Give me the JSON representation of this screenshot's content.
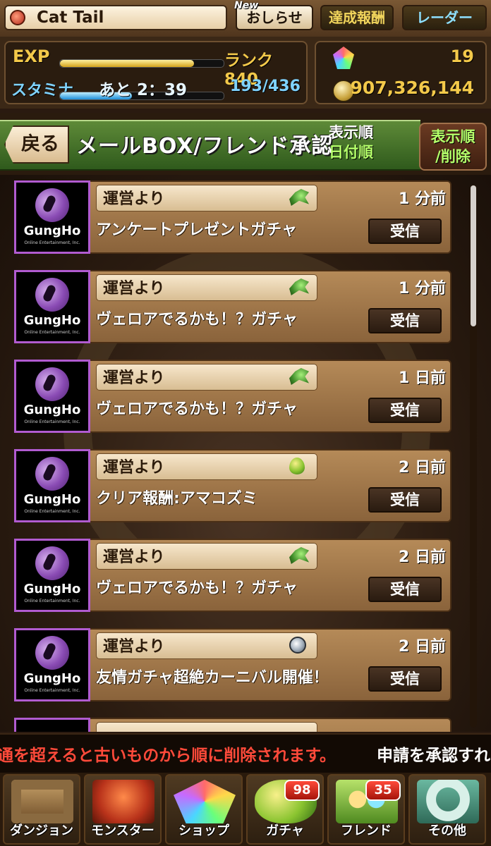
{
  "player": {
    "name": "Cat  Tail"
  },
  "header": {
    "news_new_badge": "New",
    "news_label": "おしらせ",
    "achievements_label": "達成報酬",
    "radar_label": "レーダー"
  },
  "status": {
    "exp_label": "EXP",
    "exp_progress": 0.82,
    "rank_text": "ランク 840",
    "stamina_label": "スタミナ",
    "stamina_timer": "あと 2：39",
    "stamina_value": "193/436",
    "stamina_progress": 0.44,
    "magic_stones": "19",
    "coins": "907,326,144"
  },
  "title_bar": {
    "back_label": "戻る",
    "title": "メールBOX/フレンド承認",
    "sort_label": "表示順",
    "sort_value": "日付順",
    "sort_delete_label_1": "表示順",
    "sort_delete_label_2": "/削除"
  },
  "mails": [
    {
      "logo": "GungHo",
      "logo_sub": "Online Entertainment, Inc.",
      "sender": "運営より",
      "attachment_icon": "dragon-icon",
      "time": "1 分前",
      "subject": "アンケートプレゼントガチャ",
      "button": "受信"
    },
    {
      "logo": "GungHo",
      "logo_sub": "Online Entertainment, Inc.",
      "sender": "運営より",
      "attachment_icon": "dragon-icon",
      "time": "1 分前",
      "subject": "ヴェロアでるかも！？ガチャ",
      "button": "受信"
    },
    {
      "logo": "GungHo",
      "logo_sub": "Online Entertainment, Inc.",
      "sender": "運営より",
      "attachment_icon": "dragon-icon",
      "time": "1 日前",
      "subject": "ヴェロアでるかも！？ガチャ",
      "button": "受信"
    },
    {
      "logo": "GungHo",
      "logo_sub": "Online Entertainment, Inc.",
      "sender": "運営より",
      "attachment_icon": "egg-icon",
      "time": "2 日前",
      "subject": "クリア報酬:アマコズミ",
      "button": "受信"
    },
    {
      "logo": "GungHo",
      "logo_sub": "Online Entertainment, Inc.",
      "sender": "運営より",
      "attachment_icon": "dragon-icon",
      "time": "2 日前",
      "subject": "ヴェロアでるかも！？ガチャ",
      "button": "受信"
    },
    {
      "logo": "GungHo",
      "logo_sub": "Online Entertainment, Inc.",
      "sender": "運営より",
      "attachment_icon": "medal-icon",
      "time": "2 日前",
      "subject": "友情ガチャ超絶カーニバル開催！",
      "button": "受信"
    }
  ],
  "ticker": {
    "warning": "通を超えると古いものから順に削除されます。",
    "info": "申請を承認すれ"
  },
  "nav": [
    {
      "label": "ダンジョン",
      "icon": "dungeon-gate-icon",
      "badge": ""
    },
    {
      "label": "モンスター",
      "icon": "monster-dragon-icon",
      "badge": ""
    },
    {
      "label": "ショップ",
      "icon": "magic-stone-icon",
      "badge": ""
    },
    {
      "label": "ガチャ",
      "icon": "egg-icon",
      "badge": "98"
    },
    {
      "label": "フレンド",
      "icon": "friends-icon",
      "badge": "35"
    },
    {
      "label": "その他",
      "icon": "question-icon",
      "badge": ""
    }
  ],
  "colors": {
    "rare_border": "#b15bd0",
    "exp": "#f3c94a",
    "stamina": "#7fd3ff",
    "ribbon": "#4a7a2c"
  }
}
